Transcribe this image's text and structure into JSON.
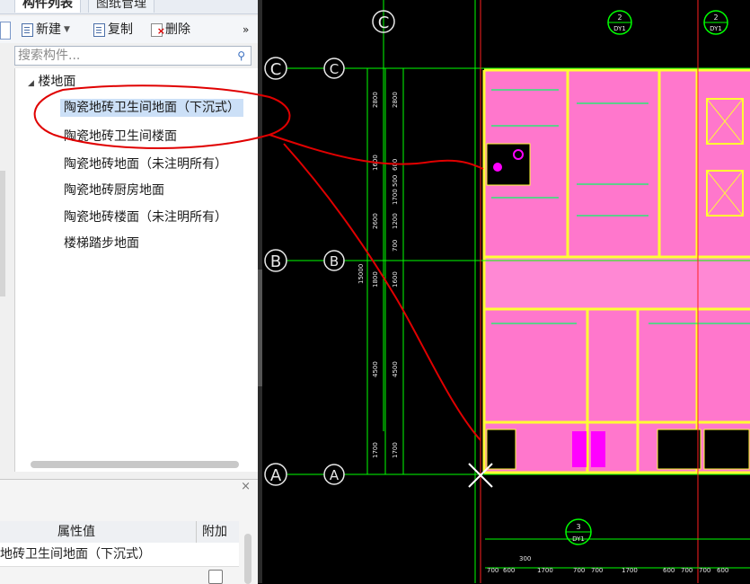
{
  "tabs": [
    "构件列表",
    "图纸管理"
  ],
  "toolbar": {
    "new_label": "新建",
    "copy_label": "复制",
    "delete_label": "删除",
    "more_icon": "»"
  },
  "search": {
    "placeholder": "搜索构件..."
  },
  "tree": {
    "group_label": "楼地面",
    "items": [
      "陶瓷地砖卫生间地面（下沉式）",
      "陶瓷地砖卫生间楼面",
      "陶瓷地砖地面（未注明所有）",
      "陶瓷地砖厨房地面",
      "陶瓷地砖楼面（未注明所有）",
      "楼梯踏步地面"
    ],
    "selected_index": 0
  },
  "properties": {
    "close_icon": "×",
    "col_value": "属性值",
    "col_extra": "附加",
    "row_value": "地砖卫生间地面（下沉式）"
  },
  "drawing": {
    "axis_labels": [
      "C",
      "B",
      "A"
    ],
    "top_callouts": [
      {
        "num": "2",
        "sub": "DY1"
      },
      {
        "num": "2",
        "sub": "DY1"
      }
    ],
    "bottom_callout": {
      "num": "3",
      "sub": "DY1"
    },
    "left_dims_outer": [
      "2800",
      "1600",
      "2600",
      "1800",
      "4500",
      "1700"
    ],
    "left_dims_inner": [
      "2800",
      "600",
      "500",
      "1700",
      "1200",
      "700",
      "1600",
      "4500",
      "1700"
    ],
    "total_dim": "15000",
    "bottom_dims": [
      "300",
      "700",
      "600",
      "1700",
      "700",
      "700",
      "1700",
      "600",
      "700",
      "700",
      "600"
    ],
    "colors": {
      "room_fill": "#ff77cc",
      "wall": "#ffff33",
      "grid": "#00ff00",
      "axis": "#e8e8e8",
      "annotation": "#e00000",
      "fixture": "#ff00ff"
    }
  }
}
